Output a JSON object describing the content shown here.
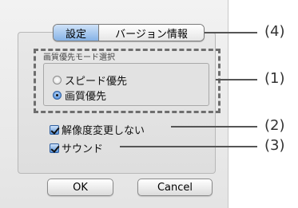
{
  "tabs": [
    {
      "label": "設定",
      "active": true
    },
    {
      "label": "バージョン情報",
      "active": false
    }
  ],
  "quality_group": {
    "title": "画質優先モード選択",
    "options": [
      {
        "label": "スピード優先",
        "selected": false
      },
      {
        "label": "画質優先",
        "selected": true
      }
    ]
  },
  "checkboxes": [
    {
      "label": "解像度変更しない",
      "checked": true
    },
    {
      "label": "サウンド",
      "checked": true
    }
  ],
  "buttons": {
    "ok": "OK",
    "cancel": "Cancel"
  },
  "callouts": [
    "(4)",
    "(1)",
    "(2)",
    "(3)"
  ],
  "colors": {
    "accent": "#3c7fd4",
    "callout_line": "#555555"
  }
}
